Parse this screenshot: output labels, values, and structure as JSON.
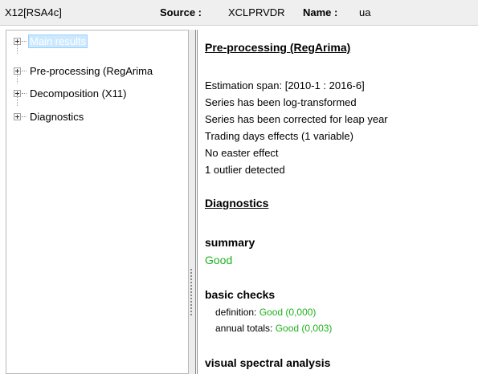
{
  "header": {
    "model": "X12[RSA4c]",
    "source_label": "Source :",
    "source_value": "XCLPRVDR",
    "name_label": "Name :",
    "name_value": "ua"
  },
  "tree": {
    "items": [
      {
        "label": "Main results",
        "selected": true
      },
      {
        "label": "Pre-processing (RegArima",
        "selected": false
      },
      {
        "label": "Decomposition (X11)",
        "selected": false
      },
      {
        "label": "Diagnostics",
        "selected": false
      }
    ]
  },
  "content": {
    "preprocessing_title": "Pre-processing (RegArima)",
    "lines": [
      "Estimation span: [2010-1 : 2016-6]",
      "Series has been log-transformed",
      "Series has been corrected for leap year",
      "Trading days effects (1 variable)",
      "No easter effect",
      "1 outlier detected"
    ],
    "diagnostics_title": "Diagnostics",
    "summary_title": "summary",
    "summary_value": "Good",
    "basic_checks_title": "basic checks",
    "definition_label": "definition: ",
    "definition_value": "Good (0,000)",
    "annual_totals_label": "annual totals: ",
    "annual_totals_value": "Good (0,003)",
    "visual_spectral_title": "visual spectral analysis"
  },
  "colors": {
    "good": "#1fb11f",
    "selection": "#cce8ff"
  }
}
